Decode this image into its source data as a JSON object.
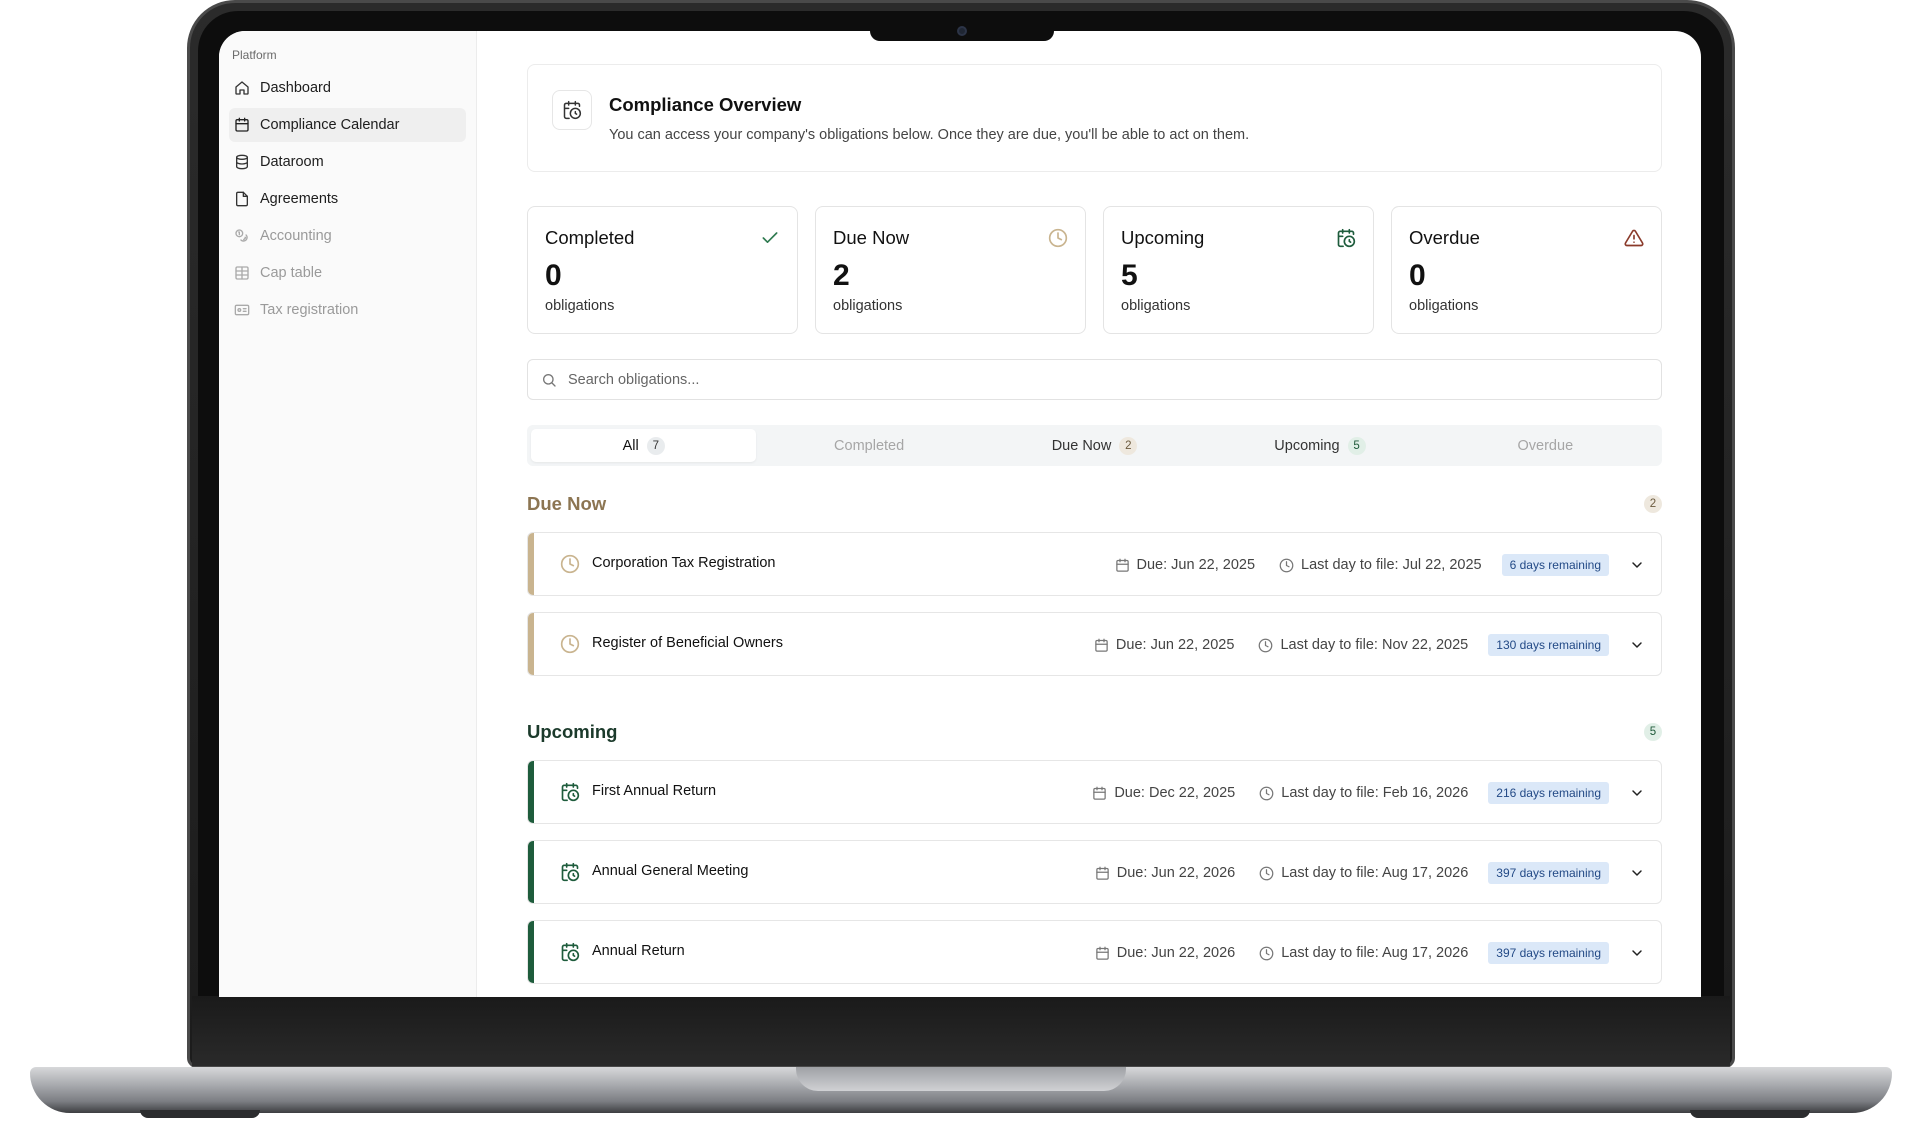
{
  "sidebar": {
    "group_label": "Platform",
    "items": [
      {
        "label": "Dashboard",
        "icon": "home-icon",
        "state": "normal"
      },
      {
        "label": "Compliance Calendar",
        "icon": "calendar-icon",
        "state": "active"
      },
      {
        "label": "Dataroom",
        "icon": "database-icon",
        "state": "normal"
      },
      {
        "label": "Agreements",
        "icon": "file-icon",
        "state": "normal"
      },
      {
        "label": "Accounting",
        "icon": "coins-icon",
        "state": "disabled"
      },
      {
        "label": "Cap table",
        "icon": "table-icon",
        "state": "disabled"
      },
      {
        "label": "Tax registration",
        "icon": "id-card-icon",
        "state": "disabled"
      }
    ]
  },
  "overview": {
    "title": "Compliance Overview",
    "subtitle": "You can access your company's obligations below. Once they are due, you'll be able to act on them."
  },
  "stats": [
    {
      "title": "Completed",
      "value": "0",
      "unit": "obligations",
      "icon": "check-icon",
      "color": "#2f7a50"
    },
    {
      "title": "Due Now",
      "value": "2",
      "unit": "obligations",
      "icon": "clock-icon",
      "color": "#c9b48f"
    },
    {
      "title": "Upcoming",
      "value": "5",
      "unit": "obligations",
      "icon": "calendar-clock-icon",
      "color": "#1e5c3c"
    },
    {
      "title": "Overdue",
      "value": "0",
      "unit": "obligations",
      "icon": "warning-icon",
      "color": "#8a3a2a"
    }
  ],
  "search": {
    "placeholder": "Search obligations..."
  },
  "tabs": [
    {
      "label": "All",
      "count": "7"
    },
    {
      "label": "Completed",
      "count": ""
    },
    {
      "label": "Due Now",
      "count": "2"
    },
    {
      "label": "Upcoming",
      "count": "5"
    },
    {
      "label": "Overdue",
      "count": ""
    }
  ],
  "sections": {
    "due_now": {
      "title": "Due Now",
      "count": "2",
      "rows": [
        {
          "title": "Corporation Tax Registration",
          "due": "Due: Jun 22, 2025",
          "last_day": "Last day to file: Jul 22, 2025",
          "remaining": "6 days remaining"
        },
        {
          "title": "Register of Beneficial Owners",
          "due": "Due: Jun 22, 2025",
          "last_day": "Last day to file: Nov 22, 2025",
          "remaining": "130 days remaining"
        }
      ]
    },
    "upcoming": {
      "title": "Upcoming",
      "count": "5",
      "rows": [
        {
          "title": "First Annual Return",
          "due": "Due: Dec 22, 2025",
          "last_day": "Last day to file: Feb 16, 2026",
          "remaining": "216 days remaining"
        },
        {
          "title": "Annual General Meeting",
          "due": "Due: Jun 22, 2026",
          "last_day": "Last day to file: Aug 17, 2026",
          "remaining": "397 days remaining"
        },
        {
          "title": "Annual Return",
          "due": "Due: Jun 22, 2026",
          "last_day": "Last day to file: Aug 17, 2026",
          "remaining": "397 days remaining"
        }
      ]
    }
  },
  "colors": {
    "due_accent": "#c9b48f",
    "upcoming_accent": "#1e5c3c",
    "remaining_badge_bg": "#dbe8f8",
    "remaining_badge_text": "#234a86"
  }
}
